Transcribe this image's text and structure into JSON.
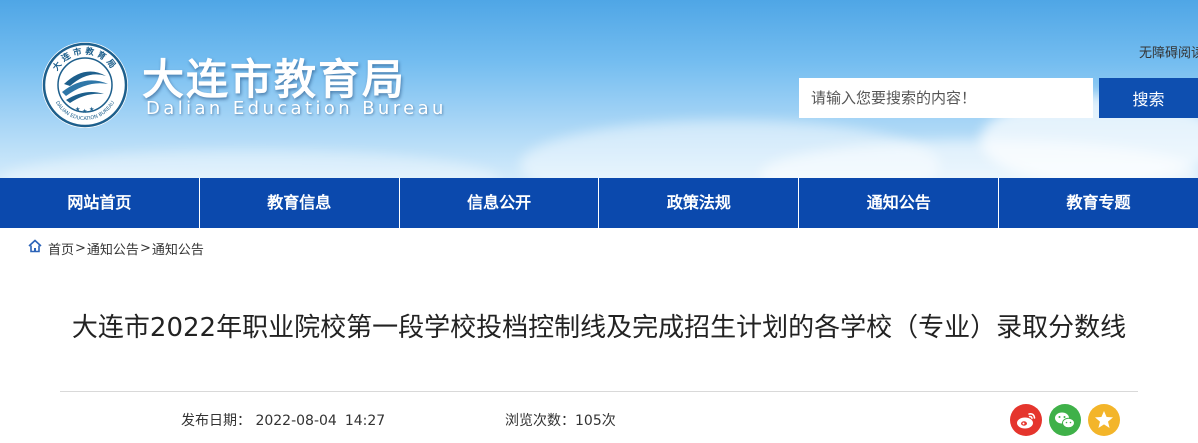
{
  "header": {
    "site_title": "大连市教育局",
    "site_subtitle": "Dalian Education Bureau",
    "accessibility_link": "无障碍阅读",
    "emblem_text": "大连市教育局",
    "emblem_ring_text": "DALIAN EDUCATION BUREAU"
  },
  "search": {
    "placeholder": "请输入您要搜索的内容！",
    "button_label": "搜索"
  },
  "nav": {
    "items": [
      {
        "label": "网站首页"
      },
      {
        "label": "教育信息"
      },
      {
        "label": "信息公开"
      },
      {
        "label": "政策法规"
      },
      {
        "label": "通知公告"
      },
      {
        "label": "教育专题"
      }
    ]
  },
  "breadcrumb": {
    "items": [
      "首页",
      "通知公告",
      "通知公告"
    ],
    "separator": ">"
  },
  "article": {
    "title": "大连市2022年职业院校第一段学校投档控制线及完成招生计划的各学校（专业）录取分数线",
    "publish_label": "发布日期：",
    "publish_date": "2022-08-04",
    "publish_time": "14:27",
    "views_label": "浏览次数：",
    "views_count": "105",
    "views_unit": "次"
  },
  "share": {
    "icons": [
      "weibo-icon",
      "wechat-icon",
      "favorite-icon"
    ]
  },
  "colors": {
    "nav_background": "#0b49ad",
    "search_button": "#0e4fb0",
    "weibo": "#e5352d",
    "wechat": "#3fb149",
    "favorite": "#f3b52a"
  }
}
